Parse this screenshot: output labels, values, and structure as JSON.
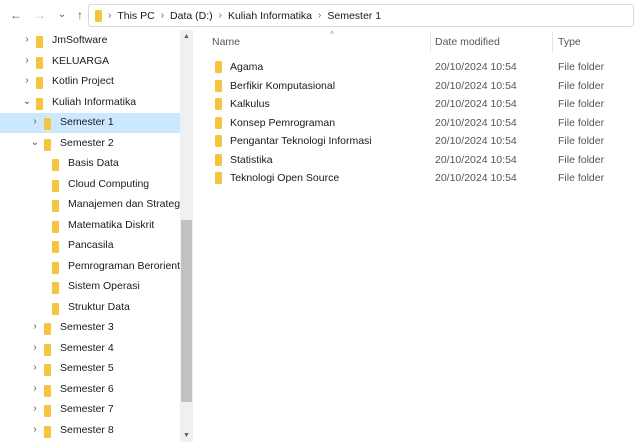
{
  "nav": {
    "back_icon": "←",
    "forward_icon": "→",
    "history_icon": "⌄",
    "up_icon": "↑"
  },
  "breadcrumb": [
    "This PC",
    "Data (D:)",
    "Kuliah Informatika",
    "Semester 1"
  ],
  "tree": [
    {
      "label": "JmSoftware",
      "chevron": "›"
    },
    {
      "label": "KELUARGA",
      "chevron": "›"
    },
    {
      "label": "Kotlin Project",
      "chevron": "›"
    },
    {
      "label": "Kuliah Informatika",
      "chevron": "⌄"
    },
    {
      "label": "Semester 1",
      "chevron": "›",
      "selected": true
    },
    {
      "label": "Semester 2",
      "chevron": "⌄"
    },
    {
      "label": "Basis Data",
      "chevron": ""
    },
    {
      "label": "Cloud Computing",
      "chevron": ""
    },
    {
      "label": "Manajemen dan Strategi",
      "chevron": ""
    },
    {
      "label": "Matematika Diskrit",
      "chevron": ""
    },
    {
      "label": "Pancasila",
      "chevron": ""
    },
    {
      "label": "Pemrograman Berorientasi",
      "chevron": ""
    },
    {
      "label": "Sistem Operasi",
      "chevron": ""
    },
    {
      "label": "Struktur Data",
      "chevron": ""
    },
    {
      "label": "Semester 3",
      "chevron": "›"
    },
    {
      "label": "Semester 4",
      "chevron": "›"
    },
    {
      "label": "Semester 5",
      "chevron": "›"
    },
    {
      "label": "Semester 6",
      "chevron": "›"
    },
    {
      "label": "Semester 7",
      "chevron": "›"
    },
    {
      "label": "Semester 8",
      "chevron": "›"
    }
  ],
  "columns": {
    "name": "Name",
    "date": "Date modified",
    "type": "Type"
  },
  "files": [
    {
      "name": "Agama",
      "date": "20/10/2024 10:54",
      "type": "File folder"
    },
    {
      "name": "Berfikir Komputasional",
      "date": "20/10/2024 10:54",
      "type": "File folder"
    },
    {
      "name": "Kalkulus",
      "date": "20/10/2024 10:54",
      "type": "File folder"
    },
    {
      "name": "Konsep Pemrograman",
      "date": "20/10/2024 10:54",
      "type": "File folder"
    },
    {
      "name": "Pengantar Teknologi Informasi",
      "date": "20/10/2024 10:54",
      "type": "File folder"
    },
    {
      "name": "Statistika",
      "date": "20/10/2024 10:54",
      "type": "File folder"
    },
    {
      "name": "Teknologi Open Source",
      "date": "20/10/2024 10:54",
      "type": "File folder"
    }
  ],
  "colors": {
    "accent": "#cce8ff",
    "folder": "#f5c542"
  }
}
